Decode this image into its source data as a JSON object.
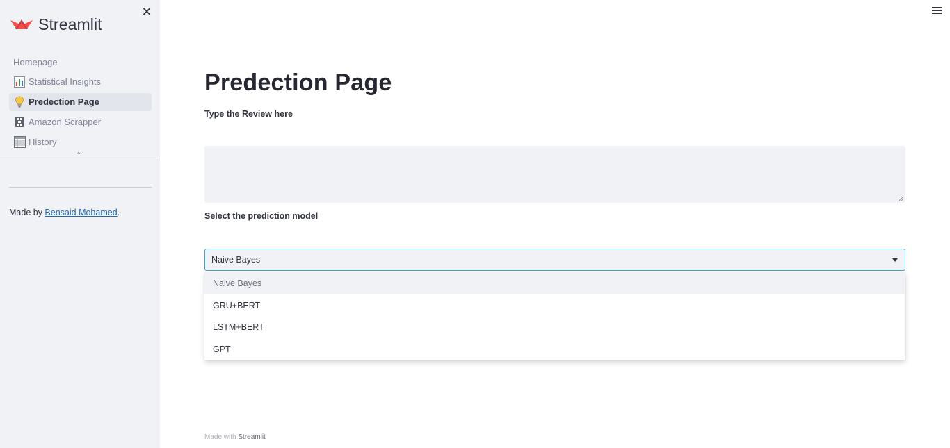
{
  "sidebar": {
    "logo_text": "Streamlit",
    "nav": [
      {
        "label": "Homepage",
        "icon": "none"
      },
      {
        "label": "Statistical Insights",
        "icon": "bar-chart-icon"
      },
      {
        "label": "Predection Page",
        "icon": "lightbulb-icon"
      },
      {
        "label": "Amazon Scrapper",
        "icon": "film-reel-icon"
      },
      {
        "label": "History",
        "icon": "spreadsheet-icon"
      }
    ],
    "active_item": "Predection Page",
    "made_by_prefix": "Made by ",
    "author": "Bensaid Mohamed",
    "made_by_suffix": "."
  },
  "main": {
    "title": "Predection Page",
    "review_label": "Type the Review here",
    "review_value": "",
    "model_label": "Select the prediction model",
    "selected_model": "Naive Bayes",
    "options": [
      "Naive Bayes",
      "GRU+BERT",
      "LSTM+BERT",
      "GPT"
    ]
  },
  "footer": {
    "prefix": "Made with",
    "brand": "Streamlit"
  },
  "colors": {
    "sidebar_bg": "#f0f2f6",
    "logo_red": "#ff4b4b",
    "link": "#1f6ab5",
    "select_border": "#41a3c8"
  }
}
